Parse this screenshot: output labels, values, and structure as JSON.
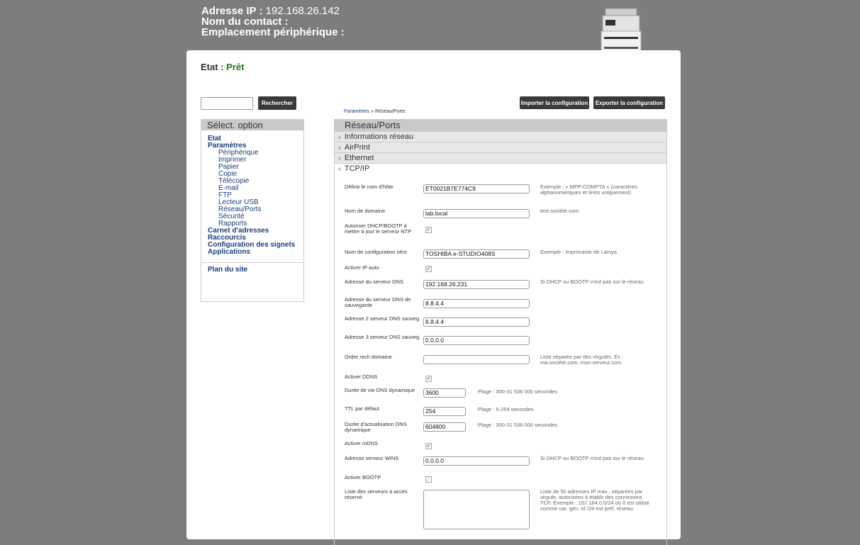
{
  "device": {
    "ip_label": "Adresse IP :",
    "ip_value": "192.168.26.142",
    "contact_label": "Nom du contact :",
    "location_label": "Emplacement périphérique :"
  },
  "status": {
    "label": "Etat :",
    "value": "Prêt"
  },
  "toolbar": {
    "search_label": "Rechercher",
    "import_label": "Importer la configuration",
    "export_label": "Exporter la configuration"
  },
  "breadcrumb": {
    "parent": "Paramètres",
    "sep": " » ",
    "current": "Réseau/Ports"
  },
  "sidebar": {
    "title": "Sélect. option",
    "items": [
      {
        "label": "Etat",
        "level": "top"
      },
      {
        "label": "Paramètres",
        "level": "top"
      },
      {
        "label": "Périphérique",
        "level": "sub"
      },
      {
        "label": "Imprimer",
        "level": "sub"
      },
      {
        "label": "Papier",
        "level": "sub"
      },
      {
        "label": "Copie",
        "level": "sub"
      },
      {
        "label": "Télécopie",
        "level": "sub"
      },
      {
        "label": "E-mail",
        "level": "sub"
      },
      {
        "label": "FTP",
        "level": "sub"
      },
      {
        "label": "Lecteur USB",
        "level": "sub"
      },
      {
        "label": "Réseau/Ports",
        "level": "sub"
      },
      {
        "label": "Sécurité",
        "level": "sub"
      },
      {
        "label": "Rapports",
        "level": "sub"
      },
      {
        "label": "Carnet d'adresses",
        "level": "top"
      },
      {
        "label": "Raccourcis",
        "level": "top"
      },
      {
        "label": "Configuration des signets",
        "level": "top"
      },
      {
        "label": "Applications",
        "level": "top"
      }
    ],
    "sitemap": "Plan du site"
  },
  "main": {
    "title": "Réseau/Ports",
    "sections": [
      "Informations réseau",
      "AirPrint",
      "Ethernet",
      "TCP/IP"
    ],
    "fields": {
      "hostname": {
        "label": "Définir le nom d'hôte",
        "value": "ET0021B7E774C9",
        "hint": "Exemple : « MFP-COMPTA » (caractères alphanumériques et tirets uniquement)"
      },
      "domain": {
        "label": "Nom de domaine",
        "value": "lab.local",
        "hint": "test.société.com"
      },
      "dhcp_ntp": {
        "label": "Autoriser DHCP/BOOTP à mettre à jour le serveur NTP",
        "checked": true
      },
      "zeroconf": {
        "label": "Nom de configuration zéro",
        "value": "TOSHIBA e-STUDIO408S",
        "hint": "Exemple : Imprimante de Lamya"
      },
      "autoip": {
        "label": "Activer IP auto",
        "checked": true
      },
      "dns": {
        "label": "Adresse du serveur DNS",
        "value": "192.168.26.231",
        "hint": "Si DHCP ou BOOTP n'est pas sur le réseau"
      },
      "dns_backup": {
        "label": "Adresse du serveur DNS de sauvegarde",
        "value": "8.8.4.4"
      },
      "dns2": {
        "label": "Adresse 2 serveur DNS sauveg.",
        "value": "8.8.4.4"
      },
      "dns3": {
        "label": "Adresse 3 serveur DNS sauveg.",
        "value": "0.0.0.0"
      },
      "search_order": {
        "label": "Ordre rech domaine",
        "value": "",
        "hint": "Liste séparée par des virgules. Ex : ma.société.com, mon.serveur.com"
      },
      "ddns": {
        "label": "Activer DDNS",
        "checked": true
      },
      "dyn_ttl": {
        "label": "Durée de vie DNS dynamique",
        "value": "3600",
        "hint": "Plage : 300-31 536 000 secondes"
      },
      "ttl": {
        "label": "TTL par défaut",
        "value": "254",
        "hint": "Plage : 5-254 secondes"
      },
      "refresh": {
        "label": "Durée d'actualisation DNS dynamique",
        "value": "604800",
        "hint": "Plage : 300-31 536 000 secondes"
      },
      "mdns": {
        "label": "Activer mDNS",
        "checked": true
      },
      "wins": {
        "label": "Adresse serveur WINS",
        "value": "0.0.0.0",
        "hint": "Si DHCP ou BOOTP n'est pas sur le réseau"
      },
      "bootp": {
        "label": "Activer BOOTP",
        "checked": false
      },
      "restricted": {
        "label": "Liste des serveurs à accès réservé",
        "value": "",
        "hint": "Liste de 50 adresses IP max., séparées par virgule, autorisées à établir des connexions TCP. Exemple : 157.184.0.0/24 où 0 est utilisé comme car. gén. et /24 est préf. réseau."
      }
    }
  }
}
